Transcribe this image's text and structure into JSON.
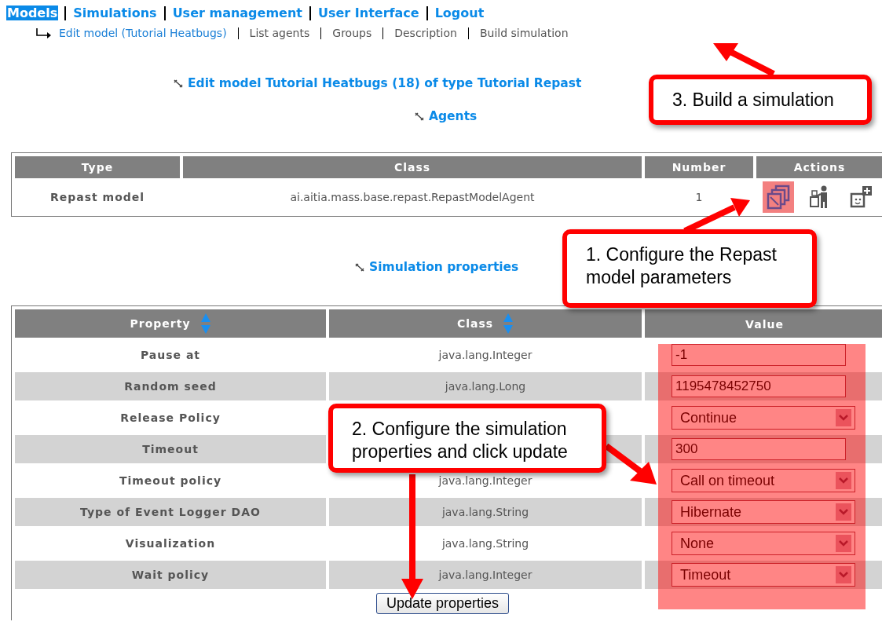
{
  "nav": {
    "items": [
      {
        "label": "Models",
        "selected": true
      },
      {
        "label": "Simulations",
        "selected": false
      },
      {
        "label": "User management",
        "selected": false
      },
      {
        "label": "User Interface",
        "selected": false
      },
      {
        "label": "Logout",
        "selected": false
      }
    ]
  },
  "subnav": {
    "items": [
      {
        "label": "Edit model (Tutorial Heatbugs)",
        "kind": "link"
      },
      {
        "label": "List agents",
        "kind": "plain"
      },
      {
        "label": "Groups",
        "kind": "plain"
      },
      {
        "label": "Description",
        "kind": "plain"
      },
      {
        "label": "Build simulation",
        "kind": "plain"
      }
    ]
  },
  "page_title": "Edit model Tutorial Heatbugs (18) of type Tutorial Repast",
  "agents": {
    "title": "Agents",
    "columns": [
      "Type",
      "Class",
      "Number",
      "Actions"
    ],
    "rows": [
      {
        "type": "Repast model",
        "class": "ai.aitia.mass.base.repast.RepastModelAgent",
        "number": "1",
        "actions": [
          {
            "kind": "copy",
            "highlighted": true
          },
          {
            "kind": "person",
            "highlighted": false
          },
          {
            "kind": "add",
            "highlighted": false
          }
        ]
      }
    ]
  },
  "properties": {
    "title": "Simulation properties",
    "value_column_highlighted": true,
    "columns": [
      {
        "label": "Property",
        "sortable": true
      },
      {
        "label": "Class",
        "sortable": true
      },
      {
        "label": "Value",
        "sortable": false
      }
    ],
    "rows": [
      {
        "property": "Pause at",
        "class": "java.lang.Integer",
        "kind": "text",
        "value": "-1"
      },
      {
        "property": "Random seed",
        "class": "java.lang.Long",
        "kind": "text",
        "value": "1195478452750"
      },
      {
        "property": "Release Policy",
        "kind": "select",
        "value": "Continue"
      },
      {
        "property": "Timeout",
        "kind": "text",
        "value": "300"
      },
      {
        "property": "Timeout policy",
        "class": "java.lang.Integer",
        "kind": "select",
        "value": "Call on timeout"
      },
      {
        "property": "Type of Event Logger DAO",
        "class": "java.lang.String",
        "kind": "select",
        "value": "Hibernate"
      },
      {
        "property": "Visualization",
        "class": "java.lang.String",
        "kind": "select",
        "value": "None"
      },
      {
        "property": "Wait policy",
        "class": "java.lang.Integer",
        "kind": "select",
        "value": "Timeout"
      }
    ],
    "update_button": "Update properties"
  },
  "callouts": [
    {
      "text": "3. Build a simulation",
      "kind": "build"
    },
    {
      "text": "1. Configure the Repast model parameters",
      "kind": "configure-model"
    },
    {
      "text": "2. Configure the simulation properties and click update",
      "kind": "configure-properties"
    }
  ]
}
